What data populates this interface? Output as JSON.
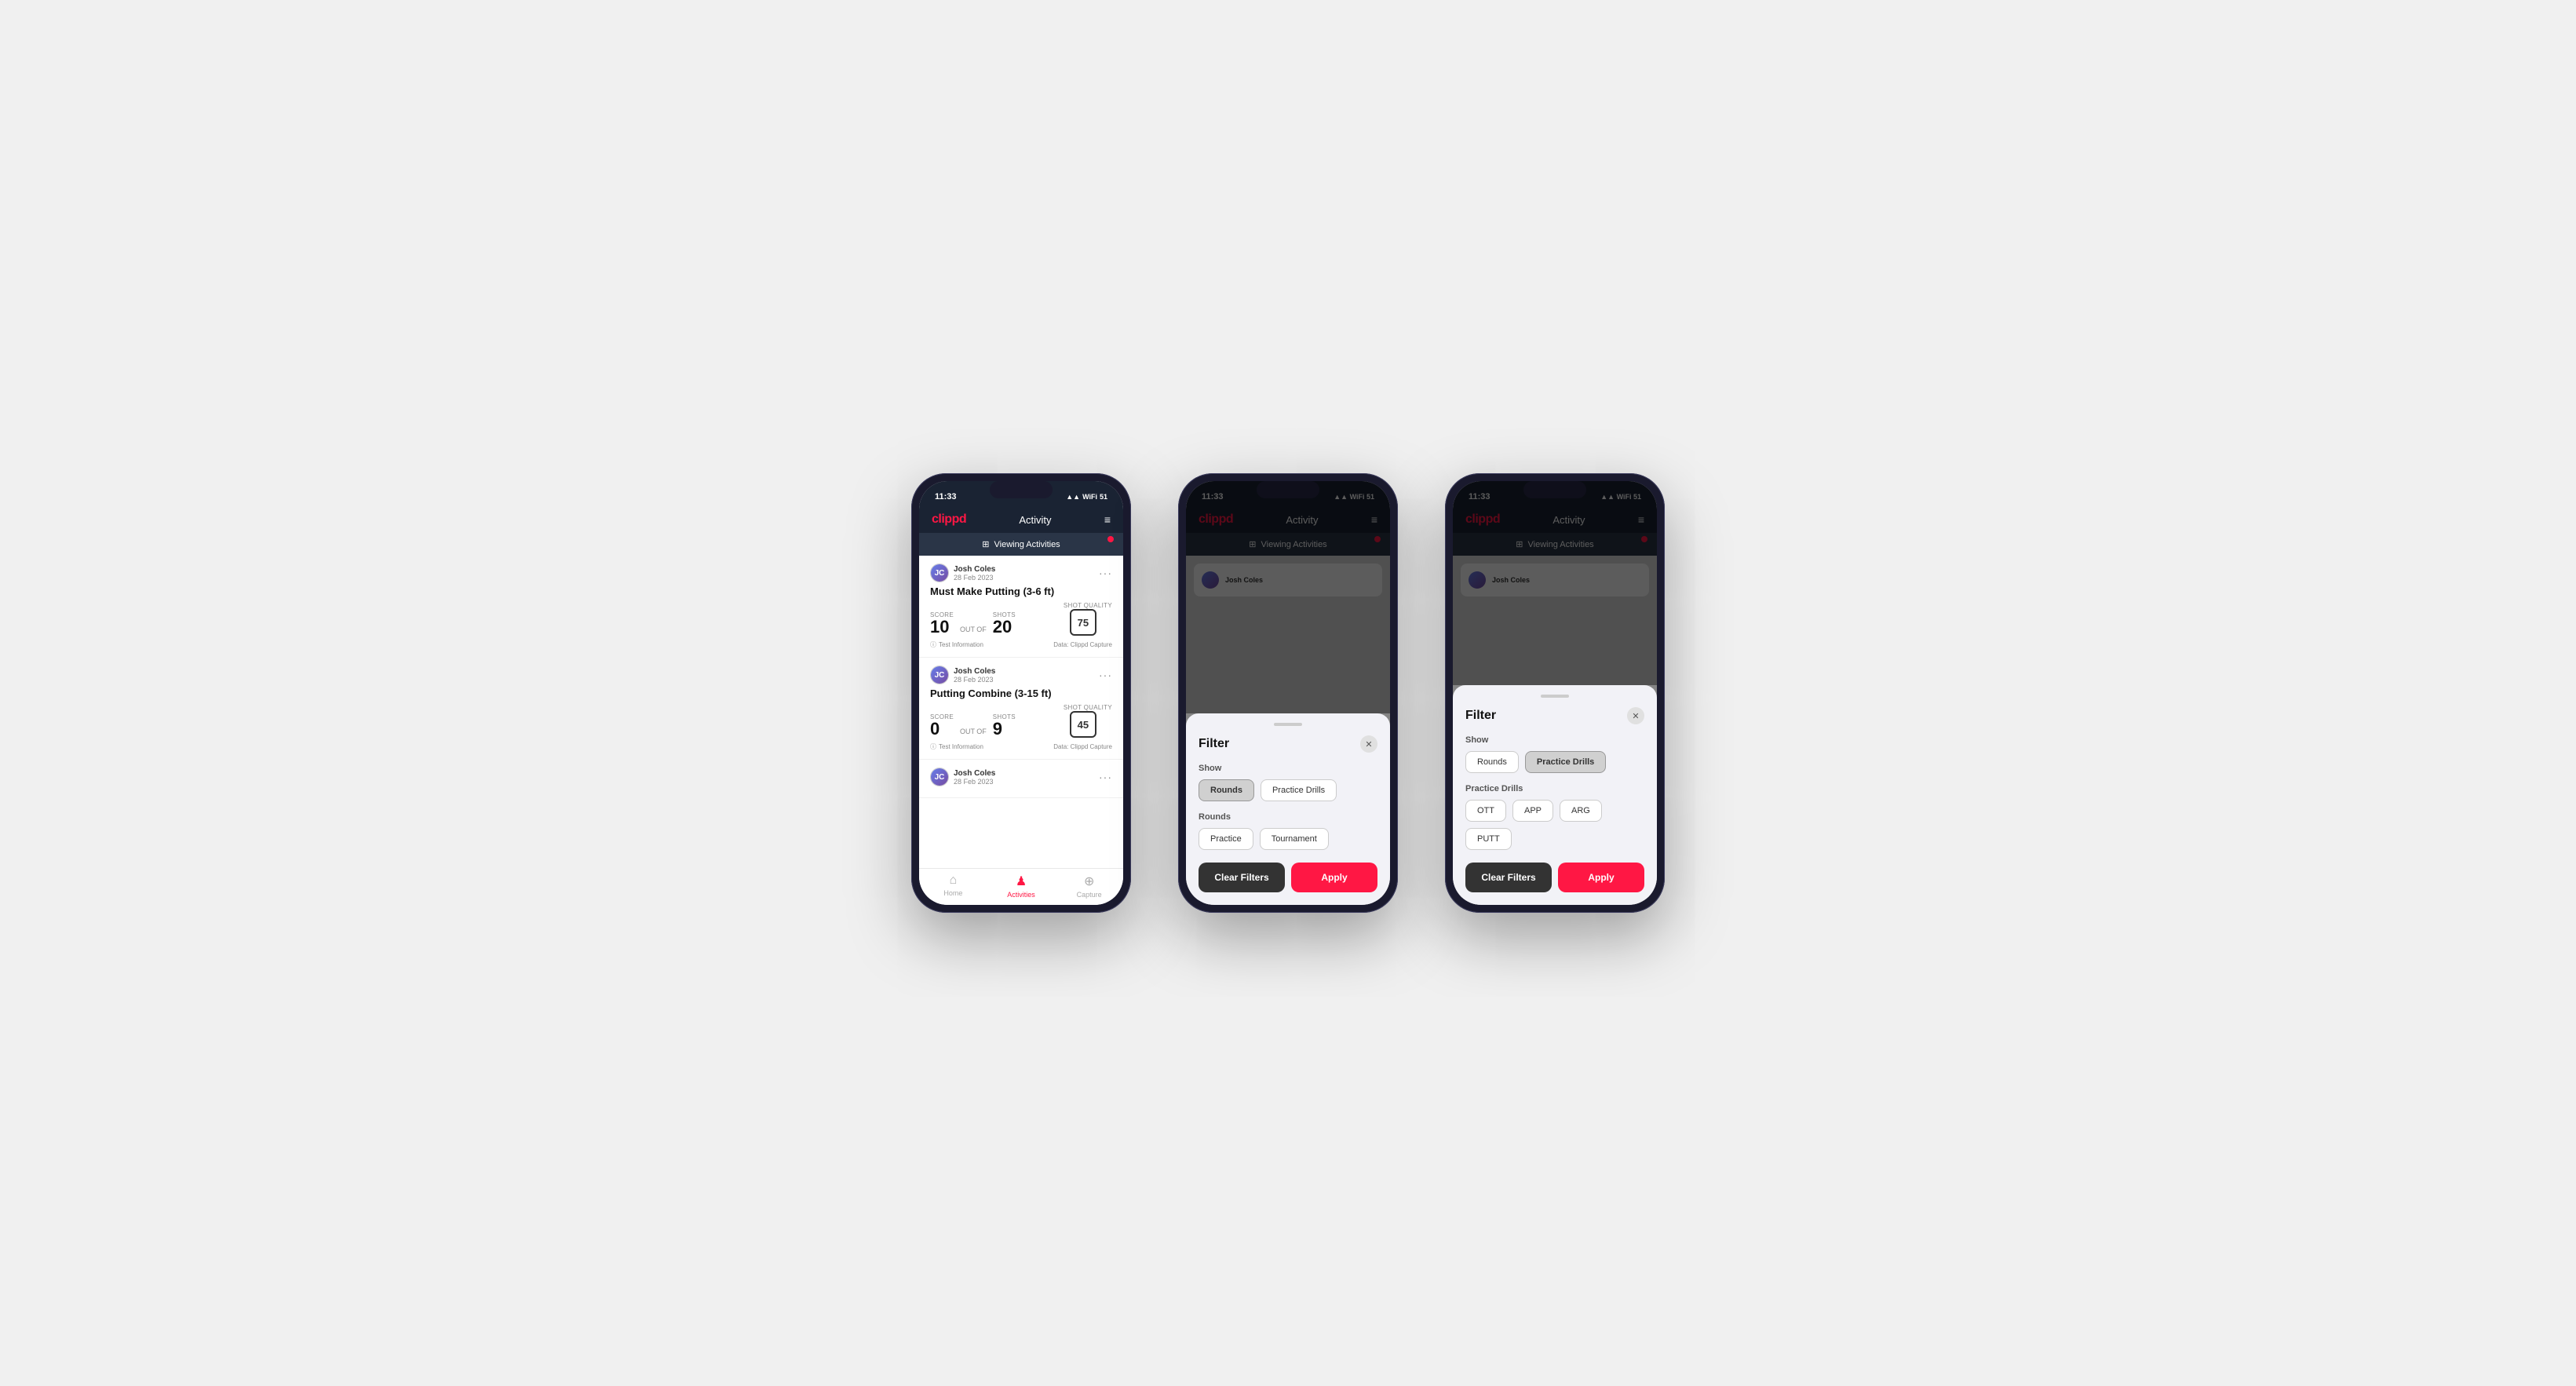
{
  "phones": [
    {
      "id": "phone1",
      "type": "activity-list",
      "statusBar": {
        "time": "11:33",
        "icons": "▲ ▲ ▲"
      },
      "header": {
        "logo": "clippd",
        "title": "Activity",
        "menuIcon": "≡"
      },
      "viewingBar": {
        "icon": "⊞",
        "text": "Viewing Activities",
        "hasRedDot": true
      },
      "activities": [
        {
          "userName": "Josh Coles",
          "userDate": "28 Feb 2023",
          "title": "Must Make Putting (3-6 ft)",
          "scoreLabel": "Score",
          "score": "10",
          "outOf": "OUT OF",
          "shots": "20",
          "shotsLabel": "Shots",
          "shotQualityLabel": "Shot Quality",
          "shotQuality": "75",
          "testInfo": "Test Information",
          "dataSource": "Data: Clippd Capture"
        },
        {
          "userName": "Josh Coles",
          "userDate": "28 Feb 2023",
          "title": "Putting Combine (3-15 ft)",
          "scoreLabel": "Score",
          "score": "0",
          "outOf": "OUT OF",
          "shots": "9",
          "shotsLabel": "Shots",
          "shotQualityLabel": "Shot Quality",
          "shotQuality": "45",
          "testInfo": "Test Information",
          "dataSource": "Data: Clippd Capture"
        },
        {
          "userName": "Josh Coles",
          "userDate": "28 Feb 2023",
          "title": "",
          "partial": true
        }
      ],
      "bottomNav": [
        {
          "icon": "⌂",
          "label": "Home",
          "active": false
        },
        {
          "icon": "♟",
          "label": "Activities",
          "active": true
        },
        {
          "icon": "⊕",
          "label": "Capture",
          "active": false
        }
      ]
    },
    {
      "id": "phone2",
      "type": "filter-rounds",
      "statusBar": {
        "time": "11:33"
      },
      "header": {
        "logo": "clippd",
        "title": "Activity",
        "menuIcon": "≡"
      },
      "viewingBar": {
        "text": "Viewing Activities",
        "hasRedDot": true
      },
      "filter": {
        "title": "Filter",
        "showLabel": "Show",
        "showButtons": [
          {
            "label": "Rounds",
            "active": true
          },
          {
            "label": "Practice Drills",
            "active": false
          }
        ],
        "roundsLabel": "Rounds",
        "roundsButtons": [
          {
            "label": "Practice",
            "active": false
          },
          {
            "label": "Tournament",
            "active": false
          }
        ],
        "clearFiltersLabel": "Clear Filters",
        "applyLabel": "Apply"
      }
    },
    {
      "id": "phone3",
      "type": "filter-practice",
      "statusBar": {
        "time": "11:33"
      },
      "header": {
        "logo": "clippd",
        "title": "Activity",
        "menuIcon": "≡"
      },
      "viewingBar": {
        "text": "Viewing Activities",
        "hasRedDot": true
      },
      "filter": {
        "title": "Filter",
        "showLabel": "Show",
        "showButtons": [
          {
            "label": "Rounds",
            "active": false
          },
          {
            "label": "Practice Drills",
            "active": true
          }
        ],
        "practiceLabel": "Practice Drills",
        "practiceButtons": [
          {
            "label": "OTT",
            "active": false
          },
          {
            "label": "APP",
            "active": false
          },
          {
            "label": "ARG",
            "active": false
          },
          {
            "label": "PUTT",
            "active": false
          }
        ],
        "clearFiltersLabel": "Clear Filters",
        "applyLabel": "Apply"
      }
    }
  ]
}
